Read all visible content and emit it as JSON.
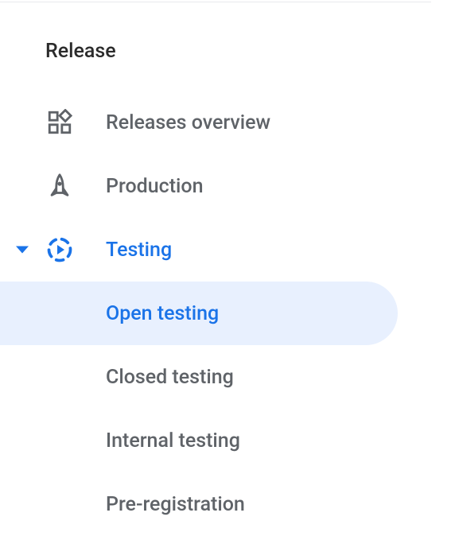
{
  "section": {
    "title": "Release"
  },
  "nav": {
    "items": [
      {
        "label": "Releases overview"
      },
      {
        "label": "Production"
      },
      {
        "label": "Testing"
      }
    ]
  },
  "testing_submenu": {
    "items": [
      {
        "label": "Open testing"
      },
      {
        "label": "Closed testing"
      },
      {
        "label": "Internal testing"
      },
      {
        "label": "Pre-registration"
      }
    ]
  }
}
